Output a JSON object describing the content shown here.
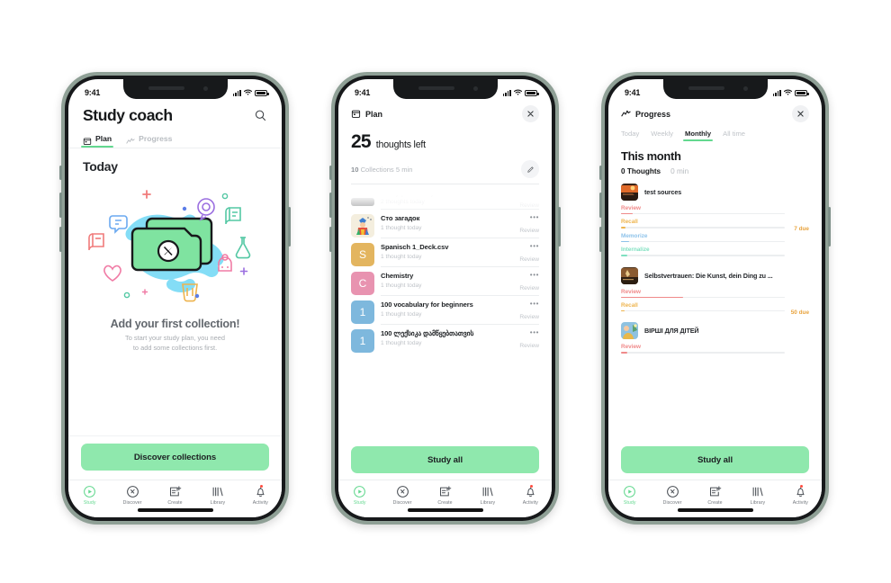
{
  "status_bar": {
    "time": "9:41"
  },
  "phone1": {
    "title": "Study coach",
    "search_icon": "search-icon",
    "tabs": [
      {
        "label": "Plan",
        "icon": "calendar-icon",
        "active": true
      },
      {
        "label": "Progress",
        "icon": "chart-line-icon",
        "active": false
      }
    ],
    "section_title": "Today",
    "illustration": "folder-compass-illustration",
    "empty_title": "Add your first collection!",
    "empty_sub_line1": "To start your study plan, you need",
    "empty_sub_line2": "to add some collections first.",
    "cta_label": "Discover collections"
  },
  "phone2": {
    "header_title": "Plan",
    "header_icon": "calendar-icon",
    "close_icon": "close-icon",
    "count": "25",
    "count_label": "thoughts left",
    "meta_collections": "10",
    "meta_collections_word": "Collections",
    "meta_duration": "5 min",
    "edit_icon": "pencil-icon",
    "rows": [
      {
        "title": "Study plan today",
        "sub": "2 thoughts today",
        "action": "Review",
        "avatar_type": "image",
        "avatar_color": "#121417",
        "avatar_letter": "",
        "faded": true
      },
      {
        "title": "Сто загадок",
        "sub": "1 thought today",
        "action": "Review",
        "avatar_type": "image",
        "avatar_color": "#f2e9d8",
        "avatar_letter": "",
        "faded": false
      },
      {
        "title": "Spanisch 1_Deck.csv",
        "sub": "1 thought today",
        "action": "Review",
        "avatar_type": "letter",
        "avatar_color": "#e3b55f",
        "avatar_letter": "S",
        "faded": false
      },
      {
        "title": "Chemistry",
        "sub": "1 thought today",
        "action": "Review",
        "avatar_type": "letter",
        "avatar_color": "#e893b0",
        "avatar_letter": "C",
        "faded": false
      },
      {
        "title": "100 vocabulary for beginners",
        "sub": "1 thought today",
        "action": "Review",
        "avatar_type": "letter",
        "avatar_color": "#7eb8dd",
        "avatar_letter": "1",
        "faded": false
      },
      {
        "title": "100 ლექსიკა დამწყებთათვის",
        "sub": "1 thought today",
        "action": "Review",
        "avatar_type": "letter",
        "avatar_color": "#7eb8dd",
        "avatar_letter": "1",
        "faded": false
      }
    ],
    "dots_label": "•••",
    "cta_label": "Study all"
  },
  "phone3": {
    "header_title": "Progress",
    "header_icon": "chart-line-icon",
    "close_icon": "close-icon",
    "tabs": [
      {
        "label": "Today",
        "active": false
      },
      {
        "label": "Weekly",
        "active": false
      },
      {
        "label": "Monthly",
        "active": true
      },
      {
        "label": "All time",
        "active": false
      }
    ],
    "period_title": "This month",
    "stat_thoughts": "0 Thoughts",
    "stat_minutes": "0 min",
    "collections": [
      {
        "name": "test sources",
        "thumb_color": "#c0522b",
        "due": "7 due",
        "bars": [
          {
            "label": "Review",
            "color": "#f08a8a",
            "pct": 7
          },
          {
            "label": "Recall",
            "color": "#eeb44e",
            "pct": 3
          },
          {
            "label": "Memorize",
            "color": "#8ec3ea",
            "pct": 5
          },
          {
            "label": "Internalize",
            "color": "#7fe0c0",
            "pct": 4
          }
        ]
      },
      {
        "name": "Selbstvertrauen: Die Kunst, dein Ding zu ...",
        "thumb_color": "#5d4526",
        "due": "50 due",
        "bars": [
          {
            "label": "Review",
            "color": "#f08a8a",
            "pct": 38
          },
          {
            "label": "Recall",
            "color": "#eeb44e",
            "pct": 2
          }
        ]
      },
      {
        "name": "ВІРШІ ДЛЯ ДІТЕЙ",
        "thumb_color": "#6fa8cf",
        "due": "",
        "bars": [
          {
            "label": "Review",
            "color": "#f08a8a",
            "pct": 4
          }
        ]
      }
    ],
    "cta_label": "Study all"
  },
  "bottom_nav": [
    {
      "label": "Study",
      "icon": "play-circle-icon",
      "active": true,
      "badge": false
    },
    {
      "label": "Discover",
      "icon": "compass-icon",
      "active": false,
      "badge": false
    },
    {
      "label": "Create",
      "icon": "note-plus-icon",
      "active": false,
      "badge": false
    },
    {
      "label": "Library",
      "icon": "books-icon",
      "active": false,
      "badge": false
    },
    {
      "label": "Activity",
      "icon": "bell-icon",
      "active": false,
      "badge": true
    }
  ],
  "colors": {
    "accent_green": "#63d88f",
    "cta_green": "#8fe8ad",
    "frame": "#8fa096"
  }
}
